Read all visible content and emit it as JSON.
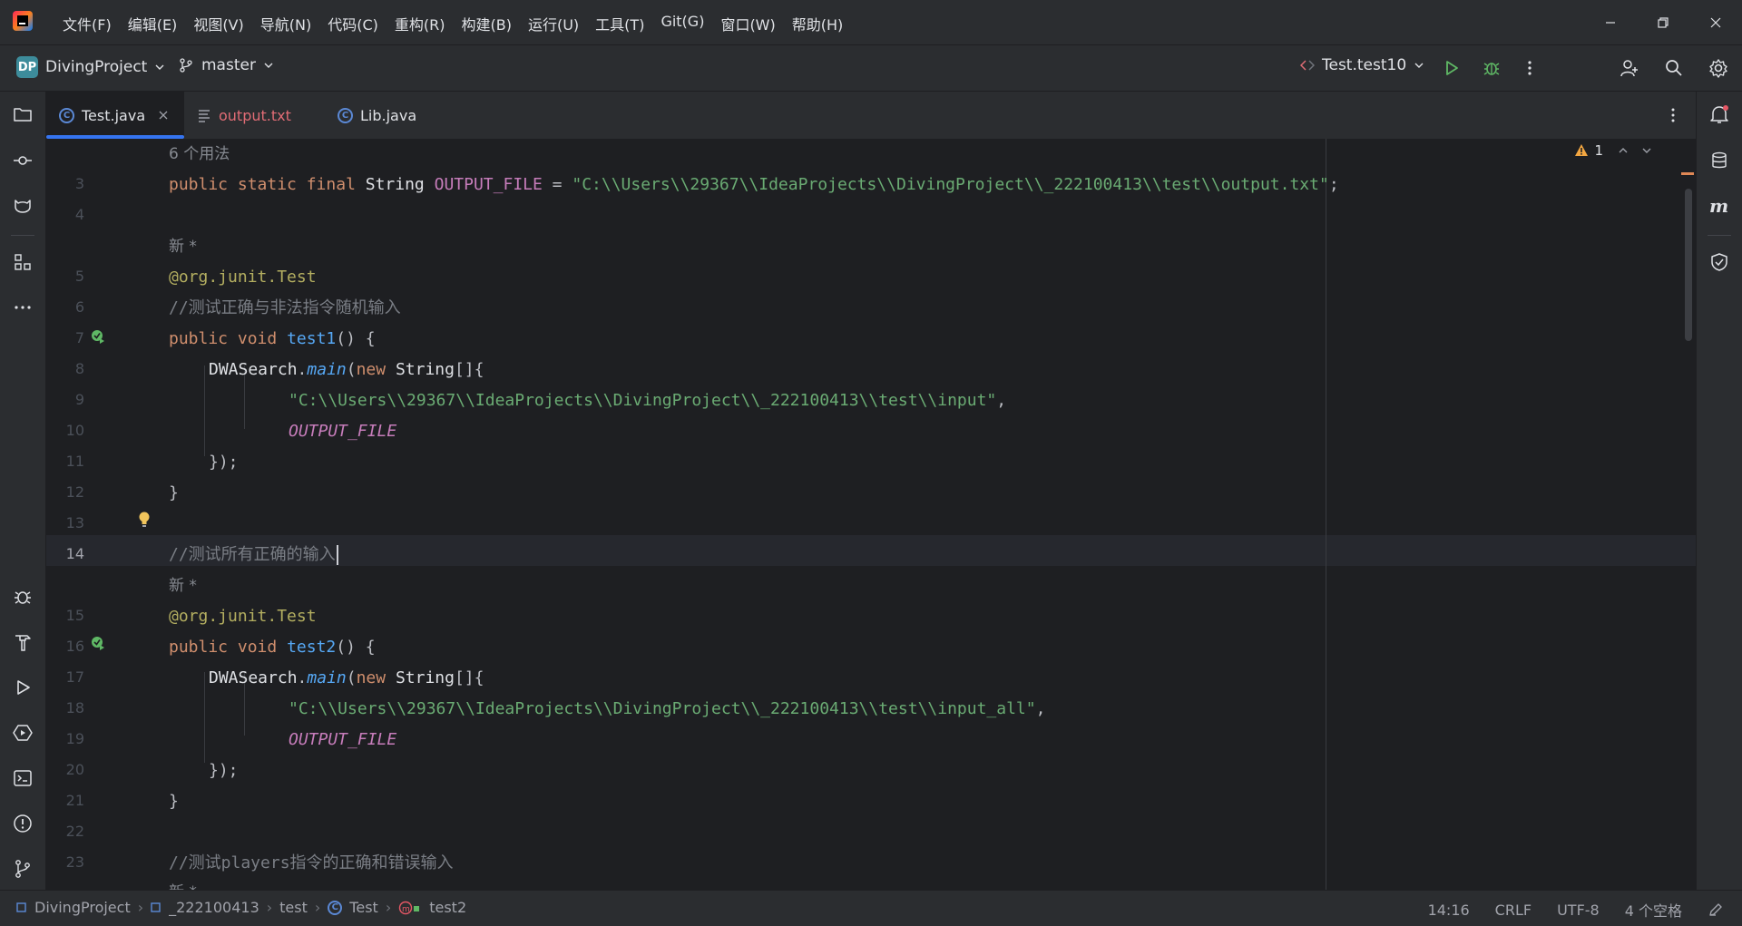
{
  "menu": [
    "文件(F)",
    "编辑(E)",
    "视图(V)",
    "导航(N)",
    "代码(C)",
    "重构(R)",
    "构建(B)",
    "运行(U)",
    "工具(T)",
    "Git(G)",
    "窗口(W)",
    "帮助(H)"
  ],
  "toolbar": {
    "project_badge": "DP",
    "project_name": "DivingProject",
    "branch": "master",
    "run_config": "Test.test10"
  },
  "tabs": [
    {
      "label": "Test.java",
      "active": true,
      "color": "#dfe1e5"
    },
    {
      "label": "output.txt",
      "active": false,
      "color": "#e06c75"
    },
    {
      "label": "Lib.java",
      "active": false,
      "color": "#dfe1e5"
    }
  ],
  "editor": {
    "warning_count": "1",
    "usages_hint": "6 个用法",
    "new_hint": "新 *",
    "line_numbers": [
      "3",
      "4",
      "5",
      "6",
      "7",
      "8",
      "9",
      "10",
      "11",
      "12",
      "13",
      "14",
      "15",
      "16",
      "17",
      "18",
      "19",
      "20",
      "21",
      "22",
      "23"
    ],
    "code": {
      "l3_mod": "public static final",
      "l3_type": "String",
      "l3_name": "OUTPUT_FILE",
      "l3_eq": " = ",
      "l3_str": "\"C:\\\\Users\\\\29367\\\\IdeaProjects\\\\DivingProject\\\\_222100413\\\\test\\\\output.txt\"",
      "l3_end": ";",
      "annotation": "@org.junit.Test",
      "cmt1": "//测试正确与非法指令随机输入",
      "void": "public void",
      "fn1": "test1",
      "fn2": "test2",
      "sig_end": "() {",
      "call_cls": "DWASearch",
      "call_dot": ".",
      "call_fn": "main",
      "call_open": "(",
      "new_kw": "new",
      "new_type": " String",
      "arr": "[]{",
      "str1": "\"C:\\\\Users\\\\29367\\\\IdeaProjects\\\\DivingProject\\\\_222100413\\\\test\\\\input\"",
      "str2": "\"C:\\\\Users\\\\29367\\\\IdeaProjects\\\\DivingProject\\\\_222100413\\\\test\\\\input_all\"",
      "comma": ",",
      "const": "OUTPUT_FILE",
      "close_call": "});",
      "close_brace": "}",
      "cmt2": "//测试所有正确的输入",
      "cmt3": "//测试players指令的正确和错误输入",
      "new_hint_bottom": "新 *"
    }
  },
  "status": {
    "crumbs": [
      "DivingProject",
      "_222100413",
      "test",
      "Test",
      "test2"
    ],
    "position": "14:16",
    "line_sep": "CRLF",
    "encoding": "UTF-8",
    "indent": "4 个空格"
  }
}
